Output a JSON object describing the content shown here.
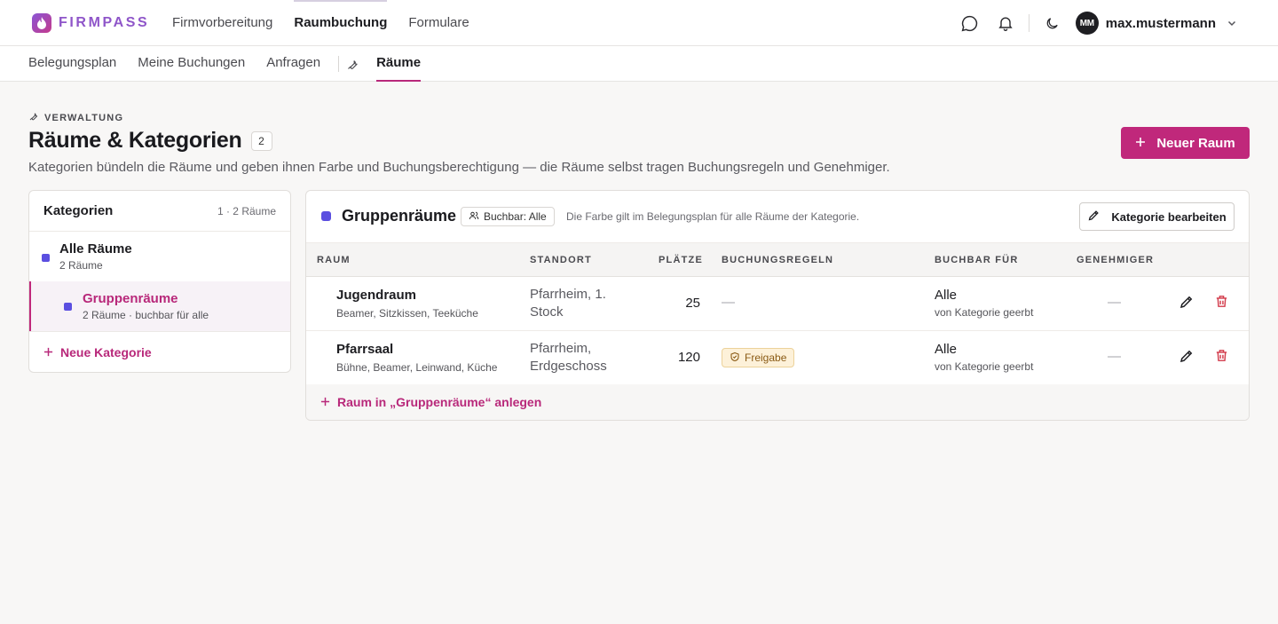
{
  "brand": {
    "name": "FIRMPASS"
  },
  "main_nav": [
    {
      "label": "Firmvorbereitung",
      "active": false
    },
    {
      "label": "Raumbuchung",
      "active": true
    },
    {
      "label": "Formulare",
      "active": false
    }
  ],
  "user": {
    "initials": "MM",
    "name": "max.mustermann"
  },
  "sub_nav": [
    {
      "label": "Belegungsplan"
    },
    {
      "label": "Meine Buchungen"
    },
    {
      "label": "Anfragen"
    }
  ],
  "sub_nav_active": "Räume",
  "header": {
    "eyebrow": "VERWALTUNG",
    "title": "Räume & Kategorien",
    "count": "2",
    "subtitle": "Kategorien bündeln die Räume und geben ihnen Farbe und Buchungsberechtigung — die Räume selbst tragen Buchungsregeln und Genehmiger.",
    "new_room_label": "Neuer Raum"
  },
  "categories_panel": {
    "title": "Kategorien",
    "summary": "1 · 2 Räume",
    "items": [
      {
        "name": "Alle Räume",
        "sub": "2 Räume"
      },
      {
        "name": "Gruppenräume",
        "sub": "2 Räume · buchbar für alle"
      }
    ],
    "new_label": "Neue Kategorie"
  },
  "category_detail": {
    "title": "Gruppenräume",
    "bookable_badge": "Buchbar: Alle",
    "hint": "Die Farbe gilt im Belegungsplan für alle Räume der Kategorie.",
    "edit_label": "Kategorie bearbeiten",
    "accent_color": "#5b4fe0",
    "columns": {
      "raum": "RAUM",
      "standort": "STANDORT",
      "plaetze": "PLÄTZE",
      "regeln": "BUCHUNGSREGELN",
      "buchbar": "BUCHBAR FÜR",
      "genehmiger": "GENEHMIGER"
    },
    "rows": [
      {
        "name": "Jugendraum",
        "features": "Beamer, Sitzkissen, Teeküche",
        "location": "Pfarrheim, 1. Stock",
        "seats": "25",
        "rule": "—",
        "bookable": "Alle",
        "bookable_sub": "von Kategorie geerbt",
        "approver": "—"
      },
      {
        "name": "Pfarrsaal",
        "features": "Bühne, Beamer, Leinwand, Küche",
        "location": "Pfarrheim, Erdgeschoss",
        "seats": "120",
        "rule": "Freigabe",
        "bookable": "Alle",
        "bookable_sub": "von Kategorie geerbt",
        "approver": "—"
      }
    ],
    "add_room_label": "Raum in „Gruppenräume“ anlegen"
  },
  "colors": {
    "brand_primary": "#c0287b",
    "category_dot": "#5b4fe0",
    "delete_red": "#d23a4a"
  }
}
